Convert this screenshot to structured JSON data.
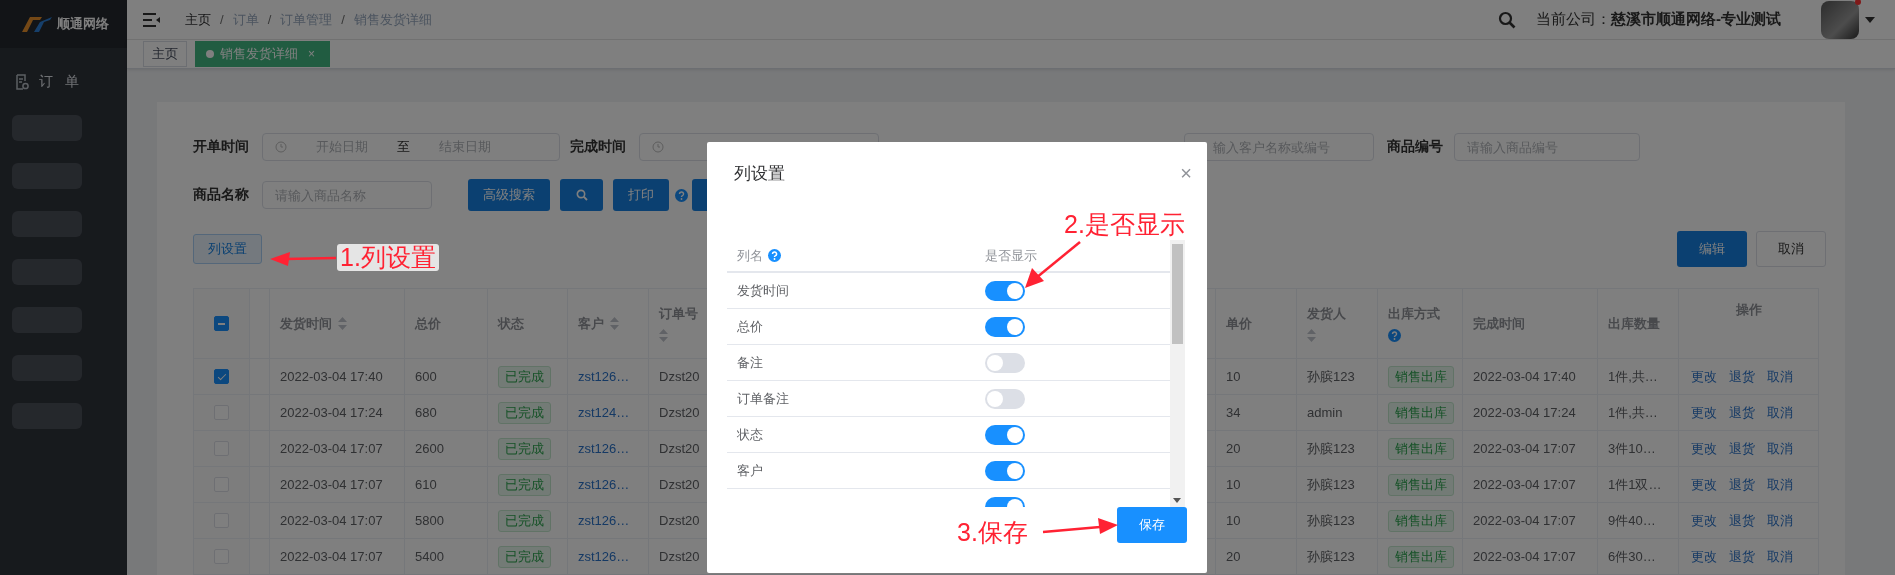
{
  "sidebar": {
    "logo": "顺通网络",
    "items": [
      {
        "label": "订 单",
        "selected": false
      }
    ]
  },
  "header": {
    "breadcrumb": [
      "主页",
      "订单",
      "订单管理",
      "销售发货详细"
    ],
    "breadcrumb_separator": "/",
    "company_label": "当前公司：",
    "company": "慈溪市顺通网络-专业测试"
  },
  "tabs": [
    {
      "label": "主页",
      "selected": false
    },
    {
      "label": "销售发货详细",
      "selected": true,
      "close": "×"
    }
  ],
  "filters": {
    "order_time": {
      "label": "开单时间",
      "start": "开始日期",
      "separator": "至",
      "end": "结束日期"
    },
    "done_time": {
      "label": "完成时间"
    },
    "customer": {
      "placeholder": "输入客户名称或编号"
    },
    "product_code": {
      "label": "商品编号",
      "placeholder": "请输入商品编号"
    },
    "product_name": {
      "label": "商品名称",
      "placeholder": "请输入商品名称"
    },
    "buttons": [
      {
        "kind": "text",
        "label": "高级搜索"
      },
      {
        "kind": "search"
      },
      {
        "kind": "text",
        "label": "打印"
      }
    ]
  },
  "column_settings_button": "列设置",
  "edit_buttons": [
    {
      "label": "编辑",
      "primary": true
    },
    {
      "label": "取消",
      "primary": false
    }
  ],
  "table": {
    "header_indeterminate": true,
    "columns": [
      {
        "label": "发货时间",
        "sortable": true
      },
      {
        "label": "总价"
      },
      {
        "label": "状态"
      },
      {
        "label": "客户",
        "sortable": true
      },
      {
        "label": "订单号",
        "sortable": true
      },
      {
        "label": "单价"
      },
      {
        "label": "发货人",
        "sortable": true
      },
      {
        "label": "出库方式",
        "help": true
      },
      {
        "label": "完成时间"
      },
      {
        "label": "出库数量"
      },
      {
        "label": "操作"
      }
    ],
    "rows": [
      {
        "selected": true,
        "time": "2022-03-04 17:40",
        "total": "600",
        "status": "已完成",
        "customer": "zst126…",
        "order": "Dzst20",
        "price": "10",
        "shipper": "孙膑123",
        "method": "销售出库",
        "done": "2022-03-04 17:40",
        "qty": "1件,共…",
        "actions": [
          "更改",
          "退货",
          "取消"
        ]
      },
      {
        "selected": false,
        "time": "2022-03-04 17:24",
        "total": "680",
        "status": "已完成",
        "customer": "zst124…",
        "order": "Dzst20",
        "price": "34",
        "shipper": "admin",
        "method": "销售出库",
        "done": "2022-03-04 17:24",
        "qty": "1件,共…",
        "actions": [
          "更改",
          "退货",
          "取消"
        ]
      },
      {
        "selected": false,
        "time": "2022-03-04 17:07",
        "total": "2600",
        "status": "已完成",
        "customer": "zst126…",
        "order": "Dzst20",
        "price": "20",
        "shipper": "孙膑123",
        "method": "销售出库",
        "done": "2022-03-04 17:07",
        "qty": "3件10…",
        "actions": [
          "更改",
          "退货",
          "取消"
        ]
      },
      {
        "selected": false,
        "time": "2022-03-04 17:07",
        "total": "610",
        "status": "已完成",
        "customer": "zst126…",
        "order": "Dzst20",
        "price": "10",
        "shipper": "孙膑123",
        "method": "销售出库",
        "done": "2022-03-04 17:07",
        "qty": "1件1双…",
        "actions": [
          "更改",
          "退货",
          "取消"
        ]
      },
      {
        "selected": false,
        "time": "2022-03-04 17:07",
        "total": "5800",
        "status": "已完成",
        "customer": "zst126…",
        "order": "Dzst20",
        "price": "10",
        "shipper": "孙膑123",
        "method": "销售出库",
        "done": "2022-03-04 17:07",
        "qty": "9件40…",
        "actions": [
          "更改",
          "退货",
          "取消"
        ]
      },
      {
        "selected": false,
        "time": "2022-03-04 17:07",
        "total": "5400",
        "status": "已完成",
        "customer": "zst126…",
        "order": "Dzst20",
        "price": "20",
        "shipper": "孙膑123",
        "method": "销售出库",
        "done": "2022-03-04 17:07",
        "qty": "6件30…",
        "actions": [
          "更改",
          "退货",
          "取消"
        ]
      }
    ]
  },
  "modal": {
    "title": "列设置",
    "close": "×",
    "name_header": "列名",
    "show_header": "是否显示",
    "save": "保存",
    "rows": [
      {
        "name": "发货时间",
        "on": true
      },
      {
        "name": "总价",
        "on": true
      },
      {
        "name": "备注",
        "on": false
      },
      {
        "name": "订单备注",
        "on": false
      },
      {
        "name": "状态",
        "on": true
      },
      {
        "name": "客户",
        "on": true
      },
      {
        "on": true
      }
    ]
  },
  "annotations": [
    {
      "text": "1.列设置"
    },
    {
      "text": "2.是否显示"
    },
    {
      "text": "3.保存"
    }
  ]
}
